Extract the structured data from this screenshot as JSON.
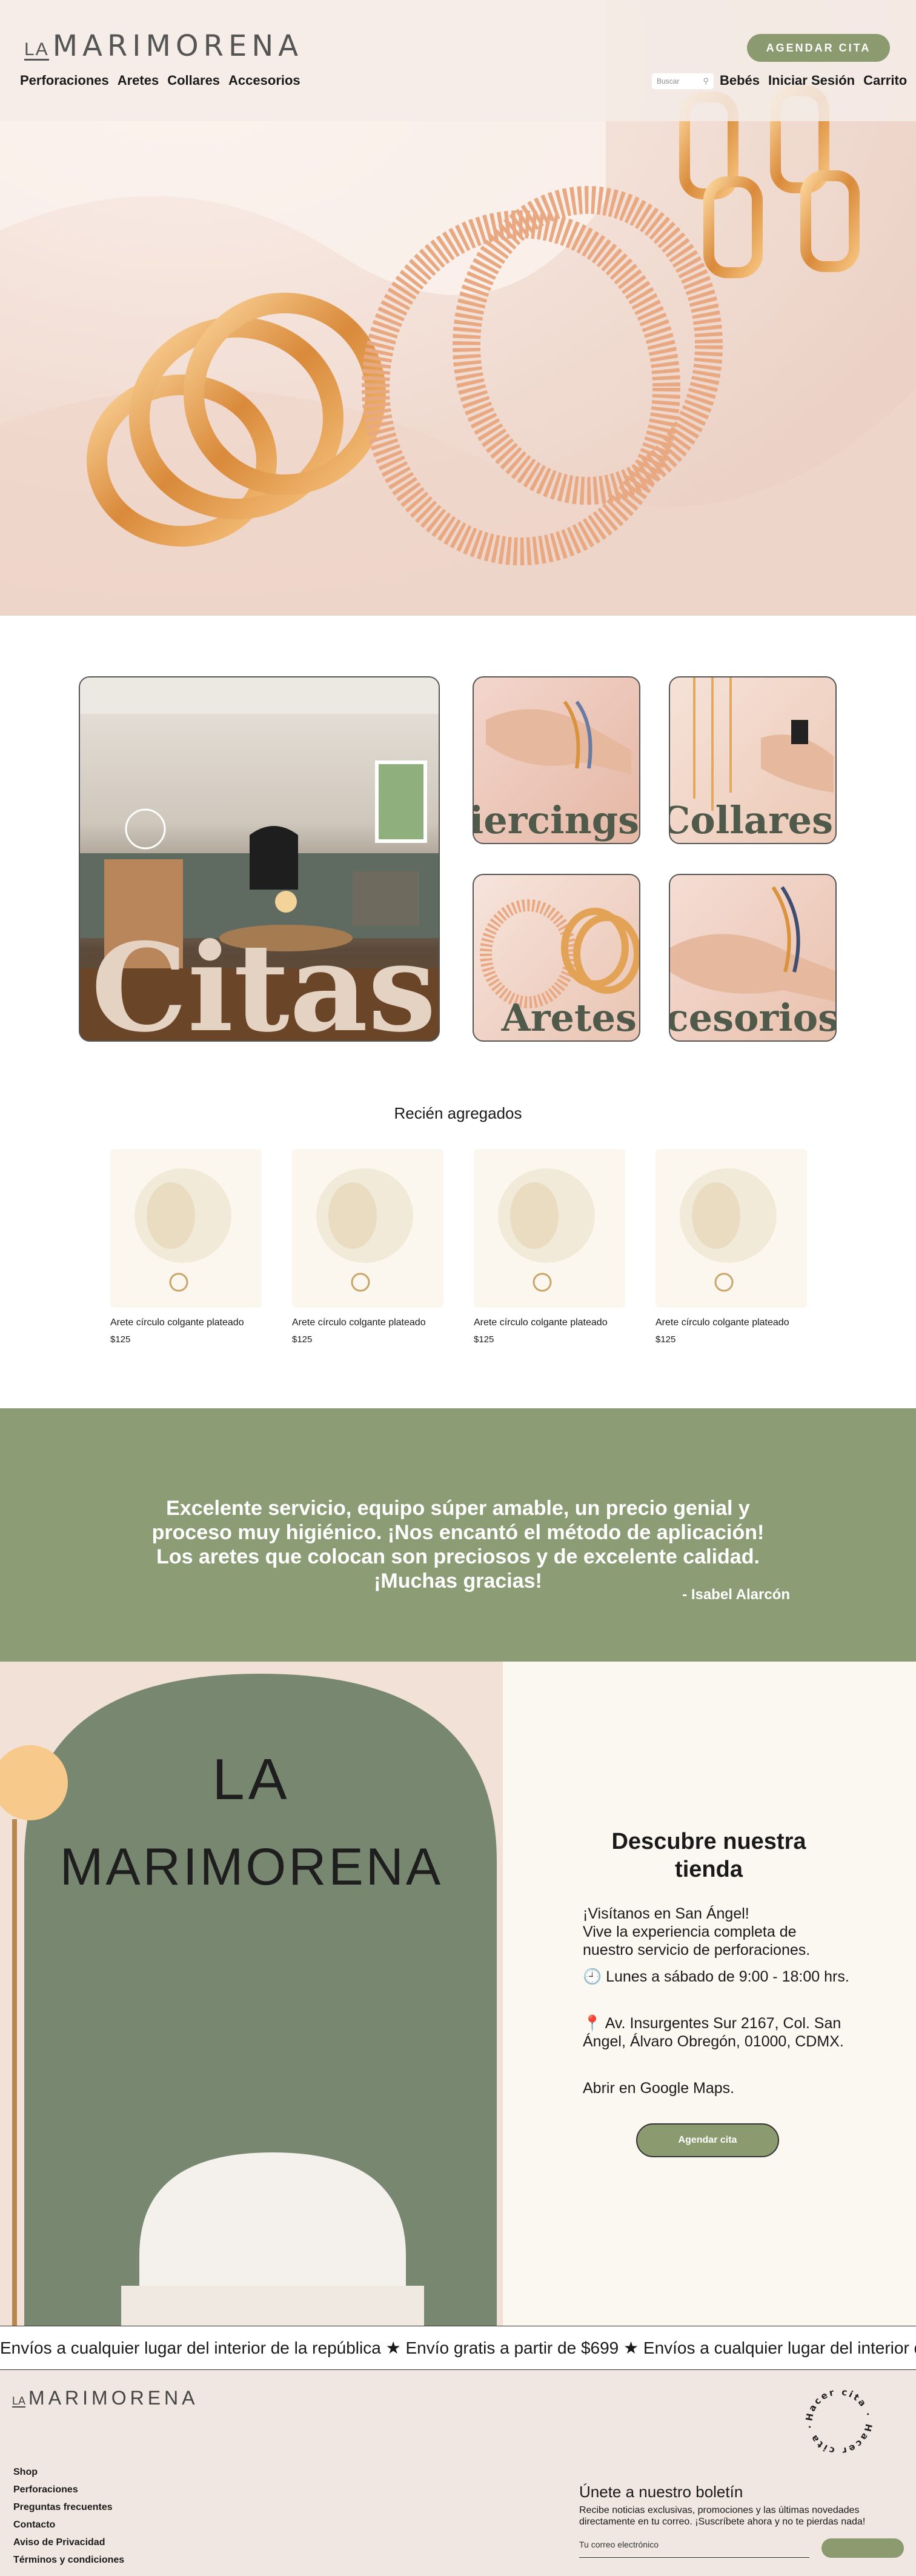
{
  "header": {
    "logo_la": "LA",
    "logo_name": "MARIMORENA",
    "cta_label": "AGENDAR CITA",
    "nav_left": [
      "Perforaciones",
      "Aretes",
      "Collares",
      "Accesorios"
    ],
    "search_placeholder": "Buscar",
    "nav_right": [
      "Bebés",
      "Iniciar Sesión",
      "Carrito"
    ]
  },
  "categories": [
    {
      "label": "Citas"
    },
    {
      "label": "Piercings"
    },
    {
      "label": "Collares"
    },
    {
      "label": "Aretes"
    },
    {
      "label": "Accesorios"
    }
  ],
  "recent": {
    "title": "Recién agregados",
    "products": [
      {
        "name": "Arete círculo colgante plateado",
        "price": "$125"
      },
      {
        "name": "Arete círculo colgante plateado",
        "price": "$125"
      },
      {
        "name": "Arete círculo colgante plateado",
        "price": "$125"
      },
      {
        "name": "Arete círculo colgante plateado",
        "price": "$125"
      }
    ]
  },
  "testimonial": {
    "quote": "Excelente servicio, equipo súper amable, un precio genial y proceso muy higiénico. ¡Nos encantó el método de aplicación! Los aretes que colocan son preciosos y de excelente calidad. ¡Muchas gracias!",
    "author": "- Isabel Alarcón"
  },
  "store": {
    "wall_line1": "LA",
    "wall_line2": "MARIMORENA",
    "title": "Descubre nuestra tienda",
    "intro": "¡Visítanos en San Ángel!\nVive la experiencia completa de nuestro servicio de perforaciones.",
    "hours": "🕘 Lunes a sábado de 9:00 - 18:00 hrs.",
    "address": "📍 Av. Insurgentes Sur 2167, Col. San Ángel, Álvaro Obregón, 01000, CDMX.",
    "maps_link": "Abrir en Google Maps.",
    "button": "Agendar cita"
  },
  "marquee": {
    "text": "Envíos a cualquier lugar del interior de la república ★ Envío gratis a partir de $699 ★ Envíos a cualquier lugar del interior de la república ★ Envío gratis a partir de $699 ★"
  },
  "footer": {
    "logo_la": "LA",
    "logo_name": "MARIMORENA",
    "badge_text": "Hacer cita · Hacer cita ·",
    "links": [
      "Shop",
      "Perforaciones",
      "Preguntas frecuentes",
      "Contacto",
      "Aviso de Privacidad",
      "Términos y condiciones"
    ],
    "newsletter_title": "Únete a nuestro boletín",
    "newsletter_desc": "Recibe noticias exclusivas, promociones y las últimas novedades directamente en tu correo. ¡Suscríbete ahora y no te pierdas nada!",
    "email_placeholder": "Tu correo electrónico"
  },
  "colors": {
    "accent_green": "#8b9a6f",
    "testimonial_bg": "#8c9c74",
    "label_green": "#4f5a4a",
    "footer_bg": "#f0e7e2"
  }
}
